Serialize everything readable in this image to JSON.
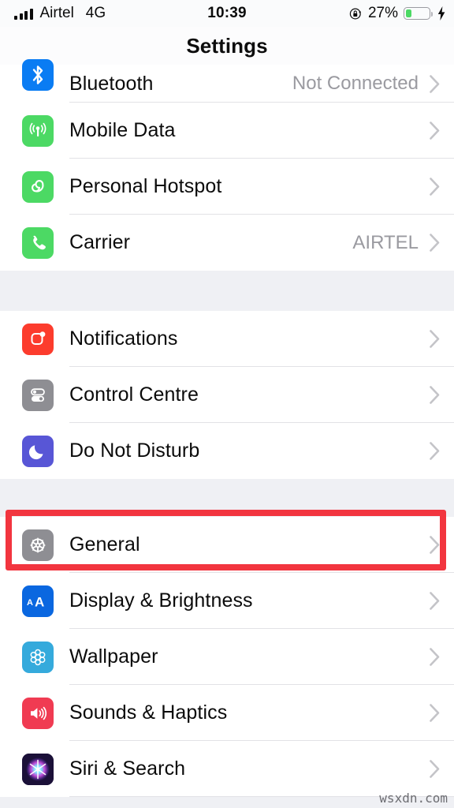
{
  "status_bar": {
    "carrier": "Airtel",
    "network": "4G",
    "time": "10:39",
    "battery_percent": "27%",
    "battery_level": 27,
    "charging": true,
    "rotation_lock": true,
    "signal_bars": 4,
    "icons": {
      "signal": "signal-bars-icon",
      "lock": "rotation-lock-icon",
      "battery": "battery-icon",
      "bolt": "charging-bolt-icon"
    }
  },
  "navbar": {
    "title": "Settings"
  },
  "groups": [
    {
      "id": "connectivity",
      "rows": [
        {
          "label": "Bluetooth",
          "value": "Not Connected",
          "icon": "bluetooth-icon",
          "icon_color": "#0a7cf3",
          "chevron": true
        },
        {
          "label": "Mobile Data",
          "value": "",
          "icon": "mobile-data-icon",
          "icon_color": "#4cd964",
          "chevron": true
        },
        {
          "label": "Personal Hotspot",
          "value": "",
          "icon": "personal-hotspot-icon",
          "icon_color": "#4cd964",
          "chevron": true
        },
        {
          "label": "Carrier",
          "value": "AIRTEL",
          "icon": "carrier-phone-icon",
          "icon_color": "#4cd964",
          "chevron": true
        }
      ]
    },
    {
      "id": "alerts",
      "rows": [
        {
          "label": "Notifications",
          "value": "",
          "icon": "notifications-icon",
          "icon_color": "#fc3c2d",
          "chevron": true
        },
        {
          "label": "Control Centre",
          "value": "",
          "icon": "control-centre-icon",
          "icon_color": "#8e8e93",
          "chevron": true
        },
        {
          "label": "Do Not Disturb",
          "value": "",
          "icon": "do-not-disturb-icon",
          "icon_color": "#5856d6",
          "chevron": true
        }
      ]
    },
    {
      "id": "system",
      "rows": [
        {
          "label": "General",
          "value": "",
          "icon": "general-gear-icon",
          "icon_color": "#8e8e93",
          "chevron": true,
          "highlighted": true
        },
        {
          "label": "Display & Brightness",
          "value": "",
          "icon": "display-brightness-icon",
          "icon_color": "#0a67e0",
          "chevron": true
        },
        {
          "label": "Wallpaper",
          "value": "",
          "icon": "wallpaper-icon",
          "icon_color": "#35aadc",
          "chevron": true
        },
        {
          "label": "Sounds & Haptics",
          "value": "",
          "icon": "sounds-haptics-icon",
          "icon_color": "#f03b52",
          "chevron": true
        },
        {
          "label": "Siri & Search",
          "value": "",
          "icon": "siri-search-icon",
          "icon_color": "#1b1038",
          "chevron": true
        }
      ]
    }
  ],
  "annotation": {
    "type": "red-rectangle-highlight",
    "target": "General",
    "color": "#f2353f"
  },
  "watermark": {
    "text": "wsxdn.com"
  },
  "colors": {
    "list_background": "#eff0f4",
    "row_background": "#ffffff",
    "separator": "#e2e2e6",
    "primary_text": "#0b0b0b",
    "secondary_text": "#9a9aa0",
    "chevron": "#c4c4c8"
  }
}
